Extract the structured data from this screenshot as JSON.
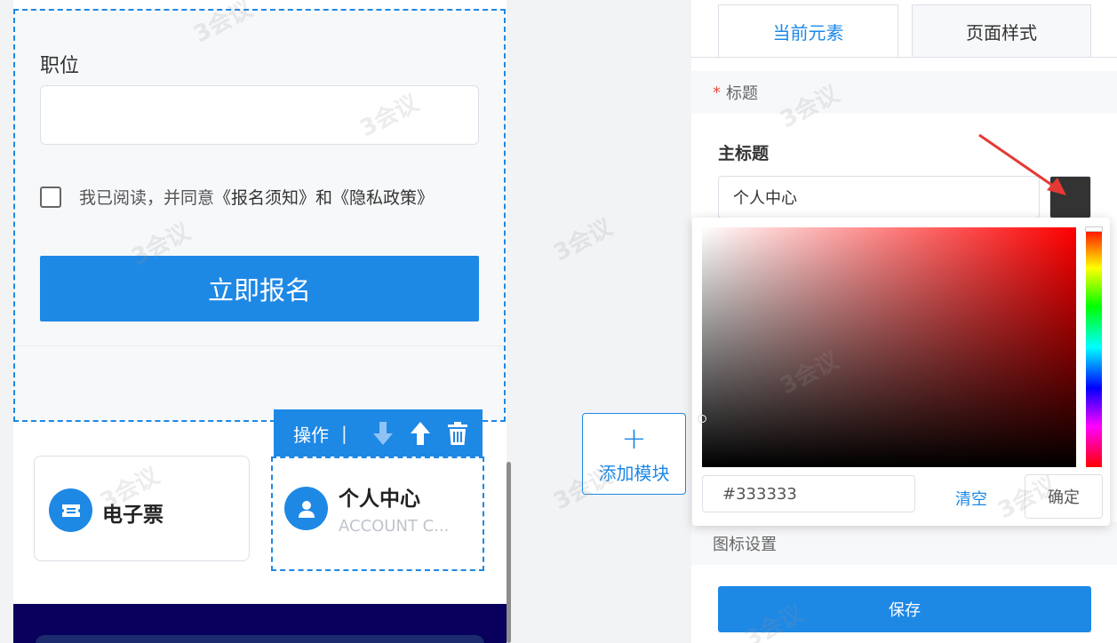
{
  "form": {
    "position_label": "职位",
    "position_value": "",
    "agree_prefix": "我已阅读，并同意",
    "agree_links": "《报名须知》和《隐私政策》",
    "submit_label": "立即报名"
  },
  "operation_bar": {
    "label": "操作",
    "separator": "|"
  },
  "cards": [
    {
      "title": "电子票",
      "icon": "ticket-icon"
    },
    {
      "title": "个人中心",
      "subtitle": "ACCOUNT C...",
      "icon": "user-icon"
    }
  ],
  "add_module": {
    "plus": "+",
    "label": "添加模块"
  },
  "panel": {
    "tabs": [
      {
        "label": "当前元素",
        "active": true
      },
      {
        "label": "页面样式",
        "active": false
      }
    ],
    "title_section": {
      "required_mark": "*",
      "label": "标题"
    },
    "main_title_label": "主标题",
    "main_title_value": "个人中心",
    "color": "#333333",
    "icon_section_label": "图标设置",
    "save_label": "保存"
  },
  "color_picker": {
    "hex_value": "#333333",
    "clear_label": "清空",
    "confirm_label": "确定"
  },
  "colors": {
    "accent": "#1e88e5",
    "banner": "#08005c",
    "required": "#e74c3c"
  },
  "watermark": "3会议"
}
